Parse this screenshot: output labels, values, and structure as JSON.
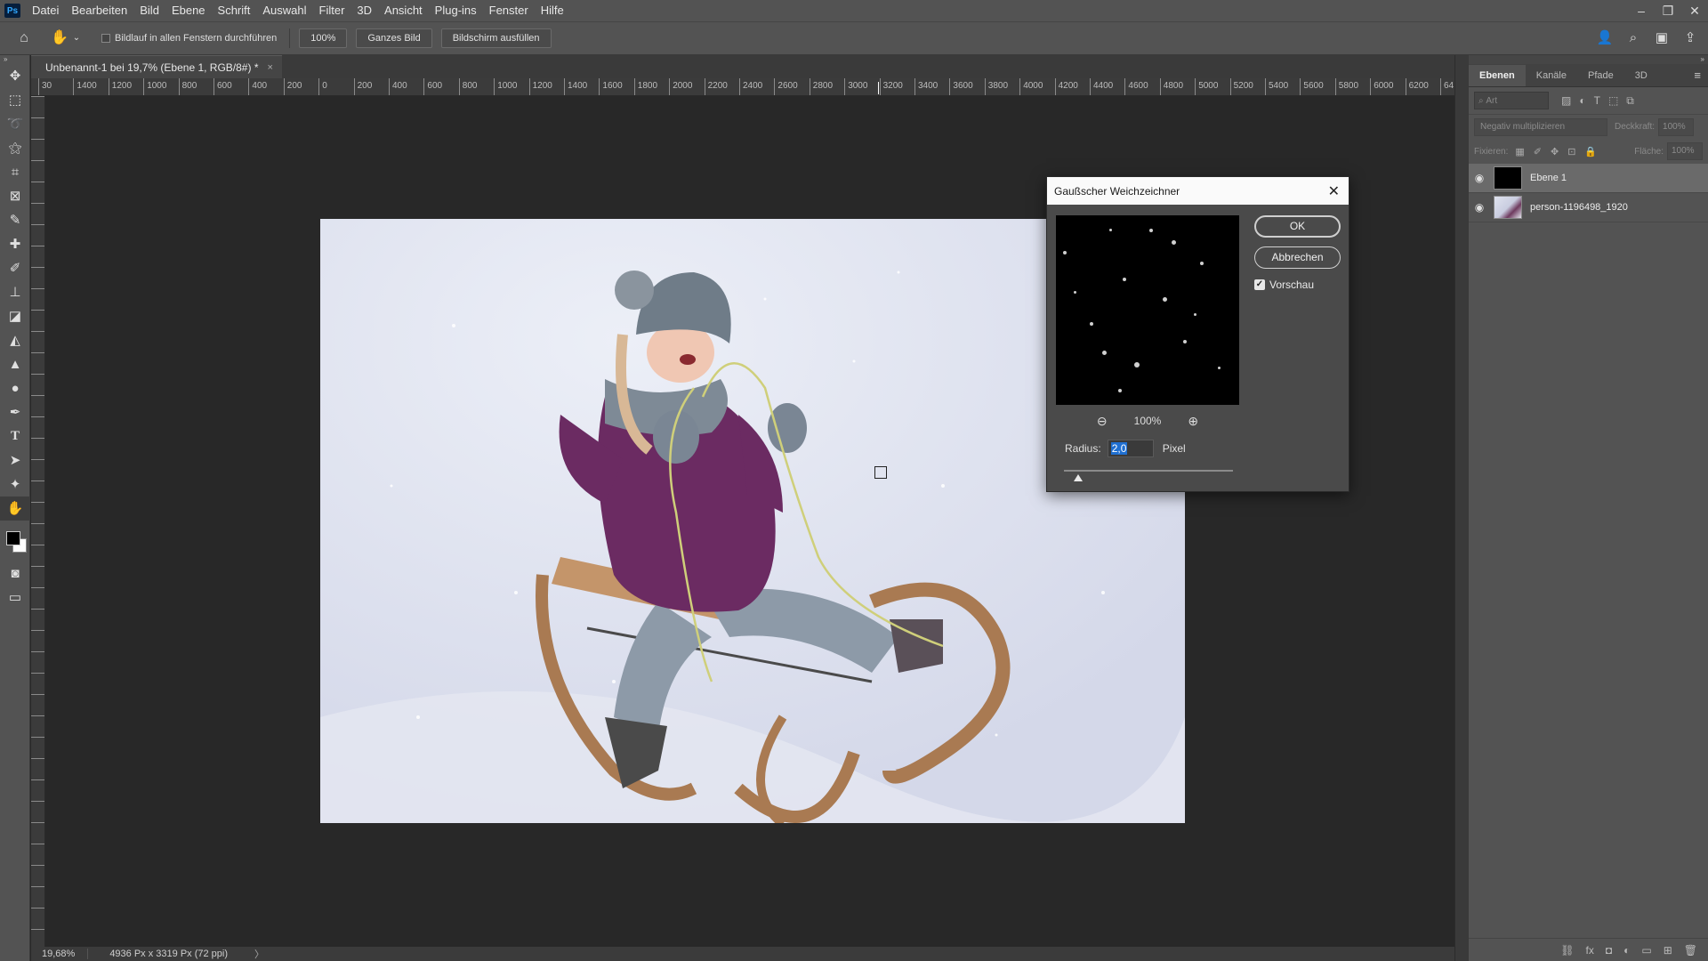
{
  "app": {
    "logo": "Ps"
  },
  "menu": [
    "Datei",
    "Bearbeiten",
    "Bild",
    "Ebene",
    "Schrift",
    "Auswahl",
    "Filter",
    "3D",
    "Ansicht",
    "Plug-ins",
    "Fenster",
    "Hilfe"
  ],
  "window_controls": {
    "minimize": "–",
    "restore": "❐",
    "close": "✕"
  },
  "options": {
    "home_icon": "home-icon",
    "hand_icon": "hand-icon",
    "scroll_all_label": "Bildlauf in allen Fenstern durchführen",
    "zoom_btn": "100%",
    "fit_btn": "Ganzes Bild",
    "fill_btn": "Bildschirm ausfüllen"
  },
  "document": {
    "tab_title": "Unbenannt-1 bei 19,7% (Ebene 1, RGB/8#) *",
    "tab_close": "×"
  },
  "ruler_labels": [
    "30",
    "1400",
    "1200",
    "1000",
    "800",
    "600",
    "400",
    "200",
    "0",
    "200",
    "400",
    "600",
    "800",
    "1000",
    "1200",
    "1400",
    "1600",
    "1800",
    "2000",
    "2200",
    "2400",
    "2600",
    "2800",
    "3000",
    "3200",
    "3400",
    "3600",
    "3800",
    "4000",
    "4200",
    "4400",
    "4600",
    "4800",
    "5000",
    "5200",
    "5400",
    "5600",
    "5800",
    "6000",
    "6200",
    "64"
  ],
  "status": {
    "zoom": "19,68%",
    "doc_size": "4936 Px x 3319 Px (72 ppi)",
    "arrow": "〉"
  },
  "tools": [
    "move-tool-icon",
    "marquee-tool-icon",
    "lasso-tool-icon",
    "magic-wand-icon",
    "crop-tool-icon",
    "frame-tool-icon",
    "eyedropper-icon",
    "healing-brush-icon",
    "brush-tool-icon",
    "clone-stamp-icon",
    "eraser-icon",
    "paint-bucket-icon",
    "sharpen-icon",
    "dodge-tool-icon",
    "pen-tool-icon",
    "type-tool-icon",
    "path-select-icon",
    "custom-shape-icon",
    "hand-tool-icon"
  ],
  "layers_panel": {
    "tabs": [
      "Ebenen",
      "Kanäle",
      "Pfade",
      "3D"
    ],
    "filter_placeholder": "Art",
    "blend_mode": "Negativ multiplizieren",
    "opacity_label": "Deckkraft:",
    "opacity_value": "100%",
    "lock_label": "Fixieren:",
    "fill_label": "Fläche:",
    "fill_value": "100%",
    "layers": [
      {
        "name": "Ebene 1",
        "selected": true
      },
      {
        "name": "person-1196498_1920",
        "selected": false
      }
    ]
  },
  "dialog": {
    "title": "Gaußscher Weichzeichner",
    "ok": "OK",
    "cancel": "Abbrechen",
    "preview_label": "Vorschau",
    "preview_checked": true,
    "zoom_level": "100%",
    "radius_label": "Radius:",
    "radius_value": "2,0",
    "radius_unit": "Pixel"
  }
}
